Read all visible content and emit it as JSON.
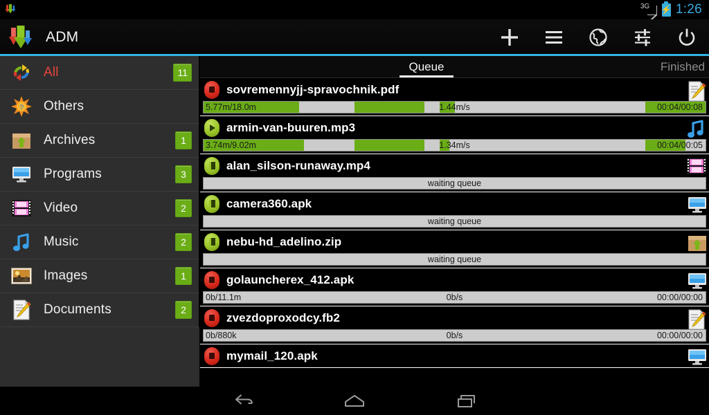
{
  "statusbar": {
    "network_label": "3G",
    "time": "1:26",
    "battery_icon": "battery-charging-icon",
    "signal_icon": "signal-3g-icon"
  },
  "actionbar": {
    "app_title": "ADM",
    "logo_icon": "adm-download-arrows-logo",
    "actions": [
      {
        "name": "add-download-button",
        "icon": "plus-icon"
      },
      {
        "name": "menu-button",
        "icon": "hamburger-menu-icon"
      },
      {
        "name": "browser-button",
        "icon": "globe-icon"
      },
      {
        "name": "settings-button",
        "icon": "sliders-icon"
      },
      {
        "name": "exit-button",
        "icon": "power-icon"
      }
    ]
  },
  "sidebar": {
    "items": [
      {
        "label": "All",
        "badge": "11",
        "icon": "refresh-arrows-icon",
        "active": true
      },
      {
        "label": "Others",
        "badge": "",
        "icon": "sunburst-icon",
        "active": false
      },
      {
        "label": "Archives",
        "badge": "1",
        "icon": "archive-box-icon",
        "active": false
      },
      {
        "label": "Programs",
        "badge": "3",
        "icon": "monitor-icon",
        "active": false
      },
      {
        "label": "Video",
        "badge": "2",
        "icon": "film-strip-icon",
        "active": false
      },
      {
        "label": "Music",
        "badge": "2",
        "icon": "music-note-icon",
        "active": false
      },
      {
        "label": "Images",
        "badge": "1",
        "icon": "picture-icon",
        "active": false
      },
      {
        "label": "Documents",
        "badge": "2",
        "icon": "document-pencil-icon",
        "active": false
      }
    ]
  },
  "tabs": [
    {
      "label": "Queue",
      "active": true
    },
    {
      "label": "Finished",
      "active": false
    }
  ],
  "downloads": [
    {
      "filename": "sovremennyjj-spravochnik.pdf",
      "state": "stop",
      "control_icon": "stop-icon",
      "type_icon": "document-pencil-icon",
      "progress_left": "5.77m/18.0m",
      "progress_mid": "1.44m/s",
      "progress_right": "00:04/00:08",
      "segments": [
        [
          0,
          19
        ],
        [
          30,
          14
        ],
        [
          47,
          3
        ],
        [
          88,
          17
        ],
        [
          131,
          6
        ]
      ],
      "waiting": ""
    },
    {
      "filename": "armin-van-buuren.mp3",
      "state": "play",
      "control_icon": "play-icon",
      "type_icon": "music-note-icon",
      "progress_left": "3.74m/9.02m",
      "progress_mid": "1.34m/s",
      "progress_right": "00:04/00:05",
      "segments": [
        [
          0,
          20
        ],
        [
          30,
          14
        ],
        [
          47,
          2
        ],
        [
          88,
          8
        ],
        [
          130,
          24
        ]
      ],
      "waiting": ""
    },
    {
      "filename": "alan_silson-runaway.mp4",
      "state": "pause",
      "control_icon": "pause-icon",
      "type_icon": "film-strip-icon",
      "progress_left": "",
      "progress_mid": "",
      "progress_right": "",
      "segments": [],
      "waiting": "waiting queue"
    },
    {
      "filename": "camera360.apk",
      "state": "pause",
      "control_icon": "pause-icon",
      "type_icon": "monitor-icon",
      "progress_left": "",
      "progress_mid": "",
      "progress_right": "",
      "segments": [],
      "waiting": "waiting queue"
    },
    {
      "filename": "nebu-hd_adelino.zip",
      "state": "pause",
      "control_icon": "pause-icon",
      "type_icon": "archive-box-icon",
      "progress_left": "",
      "progress_mid": "",
      "progress_right": "",
      "segments": [],
      "waiting": "waiting queue"
    },
    {
      "filename": "golauncherex_412.apk",
      "state": "stop",
      "control_icon": "stop-icon",
      "type_icon": "monitor-icon",
      "progress_left": "0b/11.1m",
      "progress_mid": "0b/s",
      "progress_right": "00:00/00:00",
      "segments": [],
      "waiting": ""
    },
    {
      "filename": "zvezdoproxodcy.fb2",
      "state": "stop",
      "control_icon": "stop-icon",
      "type_icon": "document-pencil-icon",
      "progress_left": "0b/880k",
      "progress_mid": "0b/s",
      "progress_right": "00:00/00:00",
      "segments": [],
      "waiting": ""
    },
    {
      "filename": "mymail_120.apk",
      "state": "stop",
      "control_icon": "stop-icon",
      "type_icon": "monitor-icon",
      "progress_left": "",
      "progress_mid": "",
      "progress_right": "",
      "segments": [],
      "waiting": ""
    }
  ],
  "navbar": [
    {
      "name": "nav-back-button",
      "icon": "back-arrow-icon"
    },
    {
      "name": "nav-home-button",
      "icon": "home-icon"
    },
    {
      "name": "nav-recents-button",
      "icon": "recents-icon"
    }
  ],
  "colors": {
    "accent": "#33b5e5",
    "badge_green": "#6aad16",
    "progress_green": "#6aad16",
    "active_item_red": "#e8453c",
    "sidebar_bg": "#2e2e2e"
  }
}
